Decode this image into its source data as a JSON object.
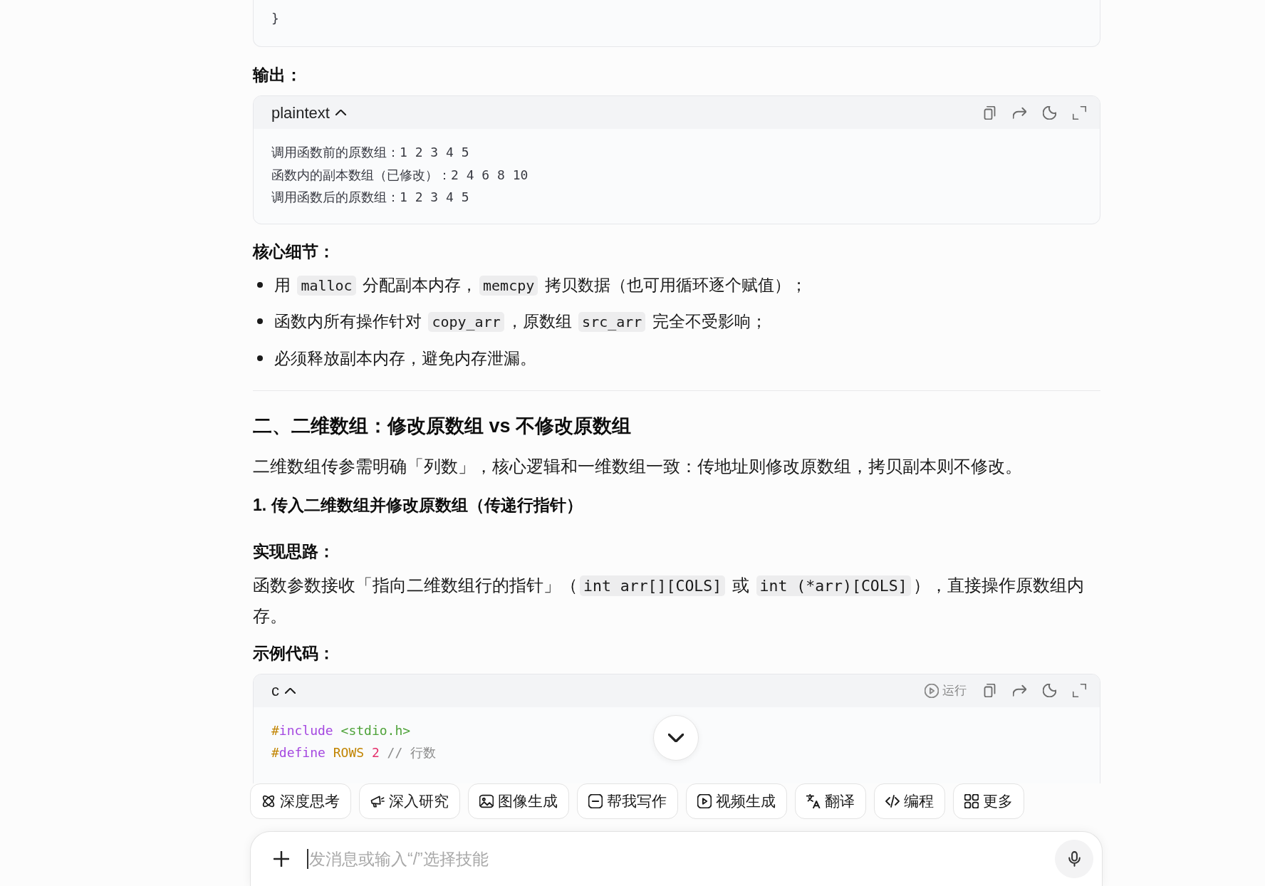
{
  "content": [
    {
      "kind": "code_tail",
      "lines": [
        [
          {
            "kind": "plain",
            "text": "}"
          }
        ]
      ]
    },
    {
      "kind": "label",
      "text": "输出："
    },
    {
      "kind": "code",
      "language": "plaintext",
      "expanded": true,
      "actions": [
        {
          "kind": "copy"
        },
        {
          "kind": "share"
        },
        {
          "kind": "theme"
        },
        {
          "kind": "fullscreen"
        }
      ],
      "lines": [
        [
          {
            "kind": "plain",
            "text": "调用函数前的原数组：1 2 3 4 5"
          }
        ],
        [
          {
            "kind": "plain",
            "text": "函数内的副本数组（已修改）：2 4 6 8 10"
          }
        ],
        [
          {
            "kind": "plain",
            "text": "调用函数后的原数组：1 2 3 4 5"
          }
        ]
      ]
    },
    {
      "kind": "label",
      "text": "核心细节："
    },
    {
      "kind": "bullets",
      "items": [
        [
          {
            "kind": "text",
            "text": "用 "
          },
          {
            "kind": "code",
            "text": "malloc"
          },
          {
            "kind": "text",
            "text": " 分配副本内存，"
          },
          {
            "kind": "code",
            "text": "memcpy"
          },
          {
            "kind": "text",
            "text": " 拷贝数据（也可用循环逐个赋值）；"
          }
        ],
        [
          {
            "kind": "text",
            "text": "函数内所有操作针对 "
          },
          {
            "kind": "code",
            "text": "copy_arr"
          },
          {
            "kind": "text",
            "text": "，原数组 "
          },
          {
            "kind": "code",
            "text": "src_arr"
          },
          {
            "kind": "text",
            "text": " 完全不受影响；"
          }
        ],
        [
          {
            "kind": "text",
            "text": "必须释放副本内存，避免内存泄漏。"
          }
        ]
      ]
    },
    {
      "kind": "divider"
    },
    {
      "kind": "h2",
      "text": "二、二维数组：修改原数组 vs 不修改原数组"
    },
    {
      "kind": "paragraph",
      "parts": [
        {
          "kind": "text",
          "text": "二维数组传参需明确「列数」，核心逻辑和一维数组一致：传地址则修改原数组，拷贝副本则不修改。"
        }
      ]
    },
    {
      "kind": "h3",
      "text": "1. 传入二维数组并修改原数组（传递行指针）"
    },
    {
      "kind": "label",
      "text": "实现思路："
    },
    {
      "kind": "paragraph",
      "parts": [
        {
          "kind": "text",
          "text": "函数参数接收「指向二维数组行的指针」（"
        },
        {
          "kind": "code",
          "text": "int arr[][COLS]"
        },
        {
          "kind": "text",
          "text": " 或 "
        },
        {
          "kind": "code",
          "text": "int (*arr)[COLS]"
        },
        {
          "kind": "text",
          "text": "），直接操作原数组内存。"
        }
      ]
    },
    {
      "kind": "label",
      "text": "示例代码："
    },
    {
      "kind": "code",
      "language": "c",
      "expanded": true,
      "actions": [
        {
          "kind": "run",
          "label": "运行"
        },
        {
          "kind": "copy"
        },
        {
          "kind": "share"
        },
        {
          "kind": "theme"
        },
        {
          "kind": "fullscreen"
        }
      ],
      "lines": [
        [
          {
            "kind": "hash",
            "text": "#"
          },
          {
            "kind": "keyword",
            "text": "include"
          },
          {
            "kind": "string",
            "text": " <stdio.h>"
          }
        ],
        [
          {
            "kind": "hash",
            "text": "#"
          },
          {
            "kind": "keyword",
            "text": "define"
          },
          {
            "kind": "macro",
            "text": " ROWS"
          },
          {
            "kind": "number",
            "text": " 2"
          },
          {
            "kind": "comment",
            "text": " // 行数"
          }
        ]
      ]
    }
  ],
  "skills": [
    {
      "kind": "think",
      "label": "深度思考"
    },
    {
      "kind": "research",
      "label": "深入研究"
    },
    {
      "kind": "image",
      "label": "图像生成"
    },
    {
      "kind": "write",
      "label": "帮我写作"
    },
    {
      "kind": "video",
      "label": "视频生成"
    },
    {
      "kind": "translate",
      "label": "翻译"
    },
    {
      "kind": "code",
      "label": "编程"
    },
    {
      "kind": "more",
      "label": "更多"
    }
  ],
  "composer": {
    "placeholder": "发消息或输入“/”选择技能"
  }
}
